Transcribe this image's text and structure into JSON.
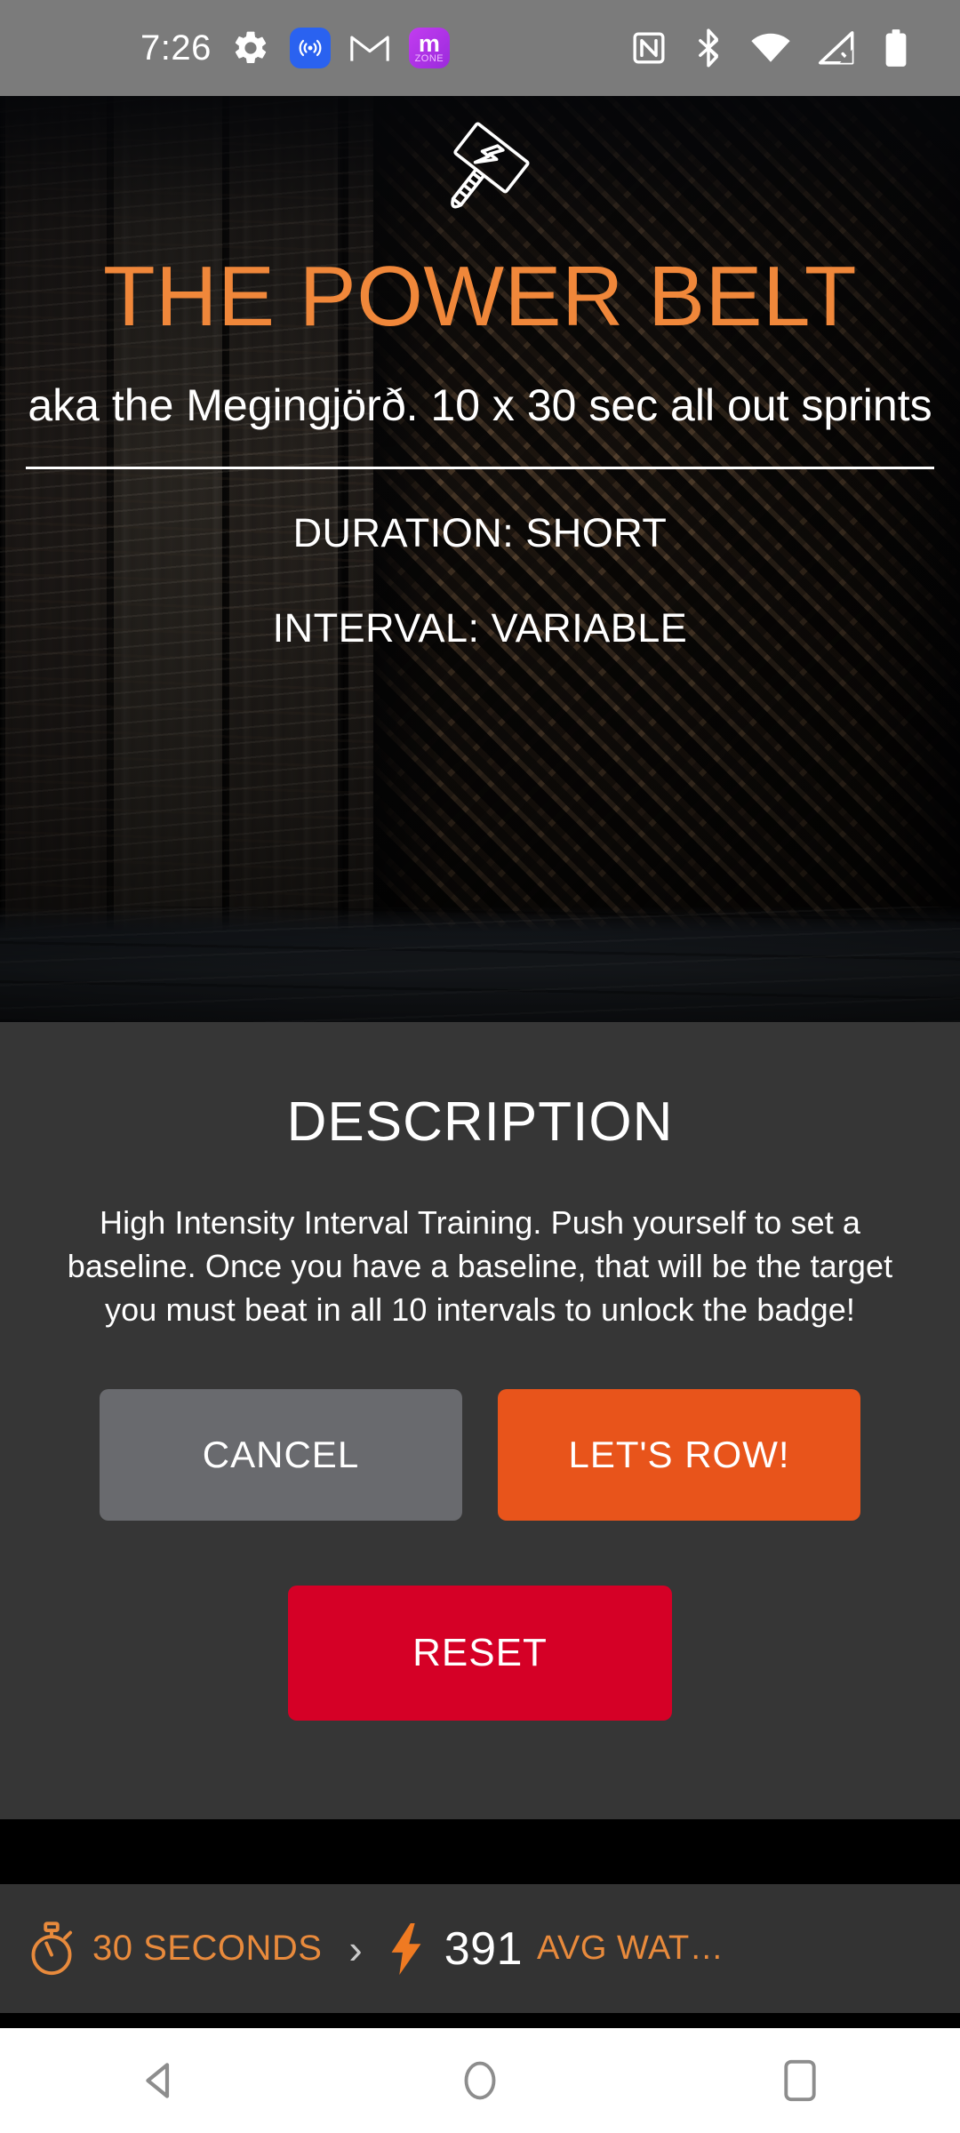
{
  "status_bar": {
    "time": "7:26",
    "background_color": "#7b7b7b",
    "left_icons": [
      {
        "name": "settings-gear-icon",
        "label": "Settings"
      },
      {
        "name": "cast-icon",
        "label": "Casting"
      },
      {
        "name": "gmail-icon",
        "label": "Gmail"
      },
      {
        "name": "mzone-icon",
        "label": "m",
        "sub_label": "ZONE"
      }
    ],
    "right_icons": [
      {
        "name": "nfc-icon",
        "label": "NFC"
      },
      {
        "name": "bluetooth-icon",
        "label": "Bluetooth"
      },
      {
        "name": "wifi-icon",
        "label": "Wi-Fi"
      },
      {
        "name": "cellular-no-signal-icon",
        "label": "No cellular signal"
      },
      {
        "name": "battery-full-icon",
        "label": "Battery full"
      }
    ]
  },
  "hero": {
    "icon_name": "mjolnir-hammer-icon",
    "title": "THE POWER BELT",
    "title_color": "#f0873a",
    "subtitle": "aka the Megingjörð. 10 x 30 sec all out sprints",
    "duration_line": "DURATION:  SHORT",
    "interval_line": "INTERVAL: VARIABLE"
  },
  "description": {
    "heading": "DESCRIPTION",
    "body": "High Intensity Interval Training. Push yourself to set a baseline. Once you have a baseline, that will be the target you must beat in all 10 intervals to unlock the badge!",
    "buttons": {
      "cancel": {
        "label": "CANCEL",
        "color": "#696a6e"
      },
      "start": {
        "label": "LET'S ROW!",
        "color": "#e8541b"
      },
      "reset": {
        "label": "RESET",
        "color": "#d50026"
      }
    }
  },
  "metric_bar": {
    "background_color": "#333333",
    "accent_color": "#e88a3c",
    "timer_icon_name": "stopwatch-icon",
    "timer_label": "30 SECONDS",
    "separator": "›",
    "power_icon_name": "lightning-bolt-icon",
    "power_value": "391",
    "power_unit": "AVG WAT…"
  },
  "navigation_bar": {
    "background_color": "#ffffff",
    "buttons": [
      {
        "name": "nav-back-button",
        "label": "Back"
      },
      {
        "name": "nav-home-button",
        "label": "Home"
      },
      {
        "name": "nav-recents-button",
        "label": "Recent apps"
      }
    ]
  }
}
